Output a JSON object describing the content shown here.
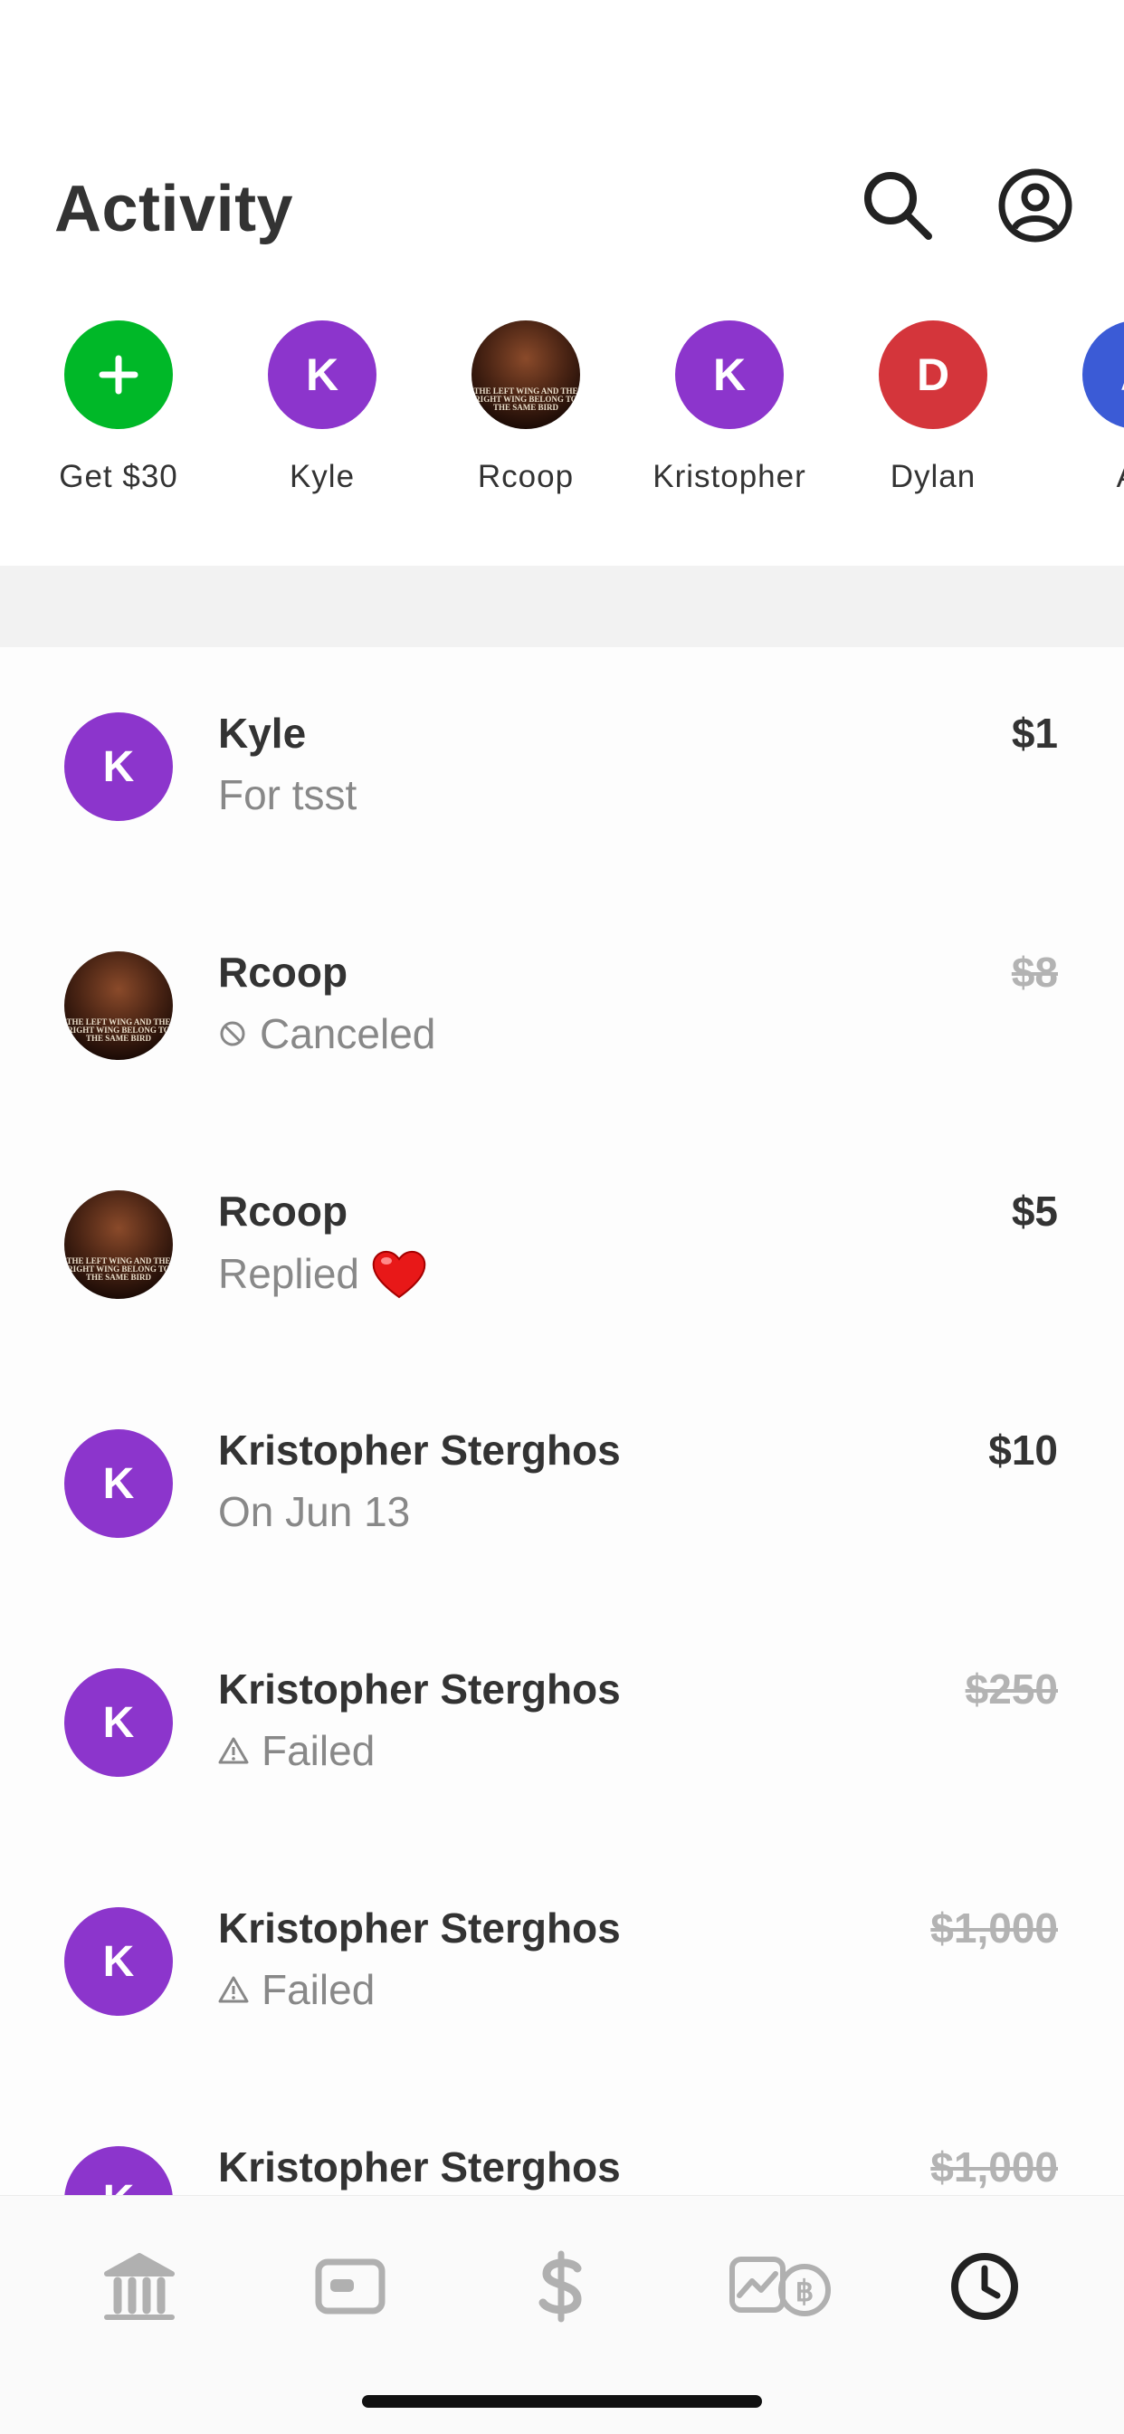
{
  "header": {
    "title": "Activity",
    "icons": [
      "search-icon",
      "profile-icon"
    ]
  },
  "contacts": [
    {
      "name": "Get $30",
      "initial": "+",
      "color": "#00b828",
      "icon": "plus-icon"
    },
    {
      "name": "Kyle",
      "initial": "K",
      "color": "#8c35cc"
    },
    {
      "name": "Rcoop",
      "initial": "",
      "color": "#3a1a0a",
      "photo_text": "THE LEFT WING AND THE RIGHT WING BELONG TO THE SAME BIRD"
    },
    {
      "name": "Kristopher",
      "initial": "K",
      "color": "#8c35cc"
    },
    {
      "name": "Dylan",
      "initial": "D",
      "color": "#d4353b"
    },
    {
      "name": "Ad",
      "initial": "A",
      "color": "#3b5bd6"
    }
  ],
  "activity": [
    {
      "name": "Kyle",
      "subtitle": "For tsst",
      "amount": "$1",
      "initial": "K",
      "color": "#8c35cc",
      "struck": false
    },
    {
      "name": "Rcoop",
      "subtitle": "Canceled",
      "status_icon": "canceled-icon",
      "amount": "$8",
      "struck": true,
      "photo": true
    },
    {
      "name": "Rcoop",
      "subtitle": "Replied",
      "reaction": "heart-icon",
      "amount": "$5",
      "struck": false,
      "photo": true
    },
    {
      "name": "Kristopher Sterghos",
      "subtitle": "On Jun 13",
      "amount": "$10",
      "initial": "K",
      "color": "#8c35cc",
      "struck": false
    },
    {
      "name": "Kristopher Sterghos",
      "subtitle": "Failed",
      "status_icon": "warning-icon",
      "amount": "$250",
      "initial": "K",
      "color": "#8c35cc",
      "struck": true
    },
    {
      "name": "Kristopher Sterghos",
      "subtitle": "Failed",
      "status_icon": "warning-icon",
      "amount": "$1,000",
      "initial": "K",
      "color": "#8c35cc",
      "struck": true
    },
    {
      "name": "Kristopher Sterghos",
      "subtitle": "",
      "amount": "$1,000",
      "initial": "K",
      "color": "#8c35cc",
      "struck": true
    }
  ],
  "tabbar": {
    "tabs": [
      "banking-icon",
      "card-icon",
      "dollar-icon",
      "investing-icon",
      "activity-clock-icon"
    ],
    "active": "activity-clock-icon",
    "active_color": "#222222",
    "inactive_color": "#b0b0b0"
  }
}
